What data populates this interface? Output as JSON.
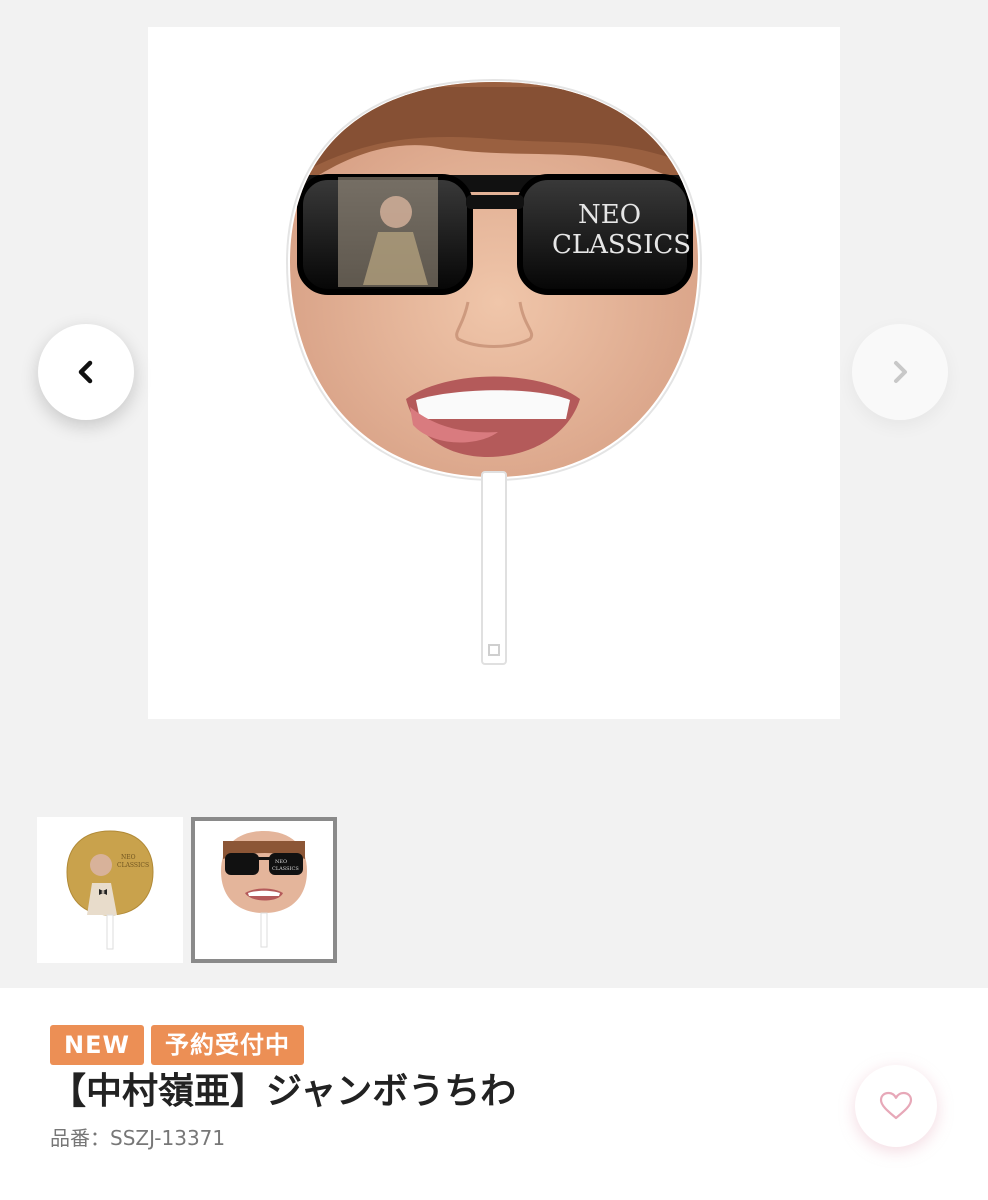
{
  "gallery": {
    "main_image": {
      "alt": "uchiwa fan with sunglasses face print",
      "print_text_line1": "NEO",
      "print_text_line2": "CLASSICS"
    },
    "prev_icon": "chevron-left-icon",
    "next_icon": "chevron-right-icon",
    "thumbnails": [
      {
        "print_text_line1": "NEO",
        "print_text_line2": "CLASSICS",
        "selected": false
      },
      {
        "print_text_line1": "NEO",
        "print_text_line2": "CLASSICS",
        "selected": true
      }
    ]
  },
  "product": {
    "badges": [
      "NEW",
      "予約受付中"
    ],
    "title": "【中村嶺亜】ジャンボうちわ",
    "code": "品番：SSZJ-13371",
    "favorite_icon": "heart-icon"
  },
  "colors": {
    "badge": "#ec8f55",
    "background": "#f2f2f2",
    "title": "#222222",
    "code": "#777777",
    "heart": "#e7a8b8"
  }
}
